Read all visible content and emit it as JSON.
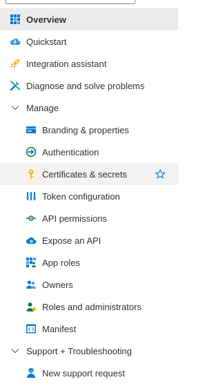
{
  "nav": {
    "overview": "Overview",
    "quickstart": "Quickstart",
    "integration_assistant": "Integration assistant",
    "diagnose": "Diagnose and solve problems",
    "manage": {
      "label": "Manage",
      "items": {
        "branding": "Branding & properties",
        "authentication": "Authentication",
        "certificates": "Certificates & secrets",
        "token": "Token configuration",
        "api_permissions": "API permissions",
        "expose_api": "Expose an API",
        "app_roles": "App roles",
        "owners": "Owners",
        "roles_admins": "Roles and administrators",
        "manifest": "Manifest"
      }
    },
    "support": {
      "label": "Support + Troubleshooting",
      "items": {
        "new_support_request": "New support request"
      }
    }
  },
  "colors": {
    "selected_bg": "#edebe9",
    "hover_bg": "#f3f2f1",
    "accent": "#0078d4"
  },
  "icons": {
    "overview": "grid-icon",
    "quickstart": "cloud-icon",
    "integration_assistant": "rocket-icon",
    "diagnose": "wrench-icon",
    "manage": "chevron-down-icon",
    "branding": "card-icon",
    "authentication": "auth-arrow-icon",
    "certificates": "key-icon",
    "token": "token-bars-icon",
    "api_permissions": "api-arrow-icon",
    "expose_api": "cloud-api-icon",
    "app_roles": "app-roles-grid-icon",
    "owners": "people-icon",
    "roles_admins": "person-admin-icon",
    "manifest": "code-file-icon",
    "favorite": "star-icon",
    "support": "chevron-down-icon",
    "new_support_request": "person-support-icon"
  }
}
